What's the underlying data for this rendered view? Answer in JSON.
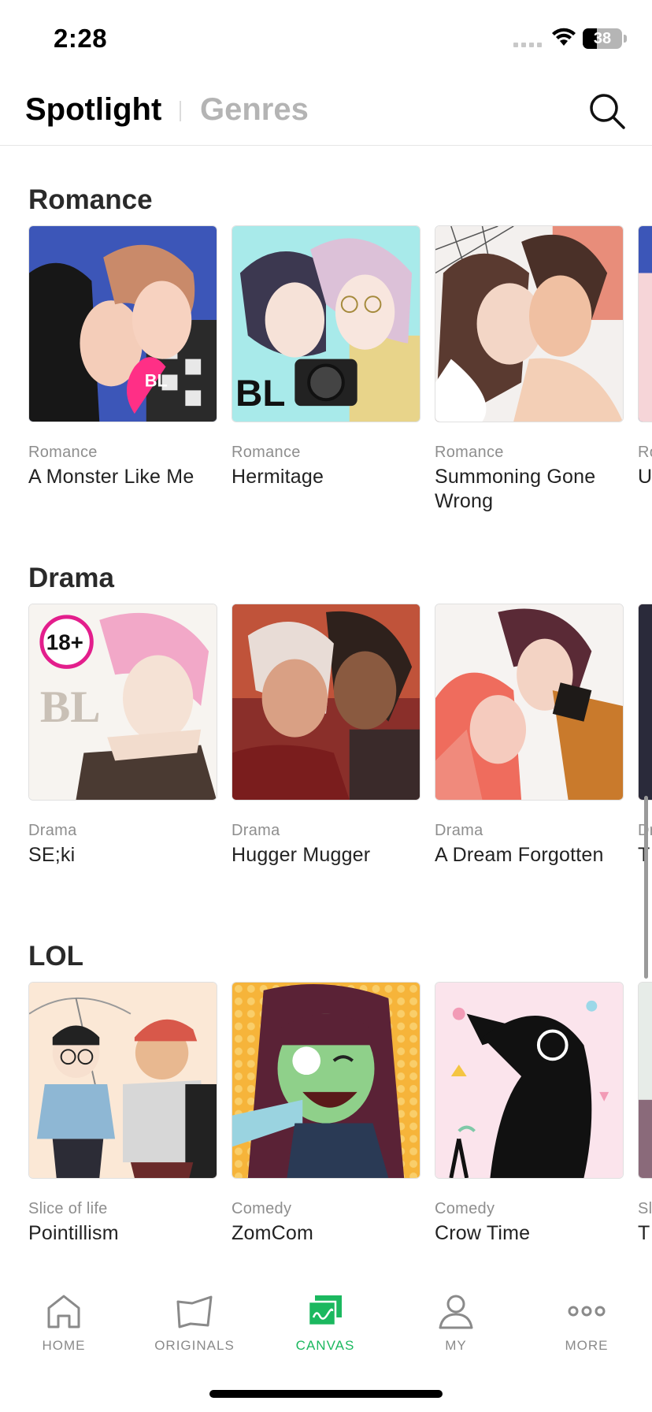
{
  "status_bar": {
    "time": "2:28",
    "battery": "38"
  },
  "header": {
    "tabs": [
      {
        "label": "Spotlight",
        "active": true
      },
      {
        "label": "Genres",
        "active": false
      }
    ],
    "search_icon": "search-icon"
  },
  "sections": [
    {
      "title": "Romance",
      "cards": [
        {
          "genre": "Romance",
          "title": "A Monster Like Me"
        },
        {
          "genre": "Romance",
          "title": "Hermitage"
        },
        {
          "genre": "Romance",
          "title": "Summoning Gone Wrong"
        },
        {
          "genre": "Ro",
          "title": "U D"
        }
      ]
    },
    {
      "title": "Drama",
      "cards": [
        {
          "genre": "Drama",
          "title": "SE;ki"
        },
        {
          "genre": "Drama",
          "title": "Hugger Mugger"
        },
        {
          "genre": "Drama",
          "title": "A Dream Forgotten"
        },
        {
          "genre": "Dr",
          "title": "T (C"
        }
      ]
    },
    {
      "title": "LOL",
      "cards": [
        {
          "genre": "Slice of life",
          "title": "Pointillism"
        },
        {
          "genre": "Comedy",
          "title": "ZomCom"
        },
        {
          "genre": "Comedy",
          "title": "Crow Time"
        },
        {
          "genre": "Sl",
          "title": "T th"
        }
      ]
    }
  ],
  "bottom_nav": [
    {
      "label": "HOME",
      "icon": "home-icon",
      "active": false
    },
    {
      "label": "ORIGINALS",
      "icon": "originals-icon",
      "active": false
    },
    {
      "label": "CANVAS",
      "icon": "canvas-icon",
      "active": true
    },
    {
      "label": "MY",
      "icon": "person-icon",
      "active": false
    },
    {
      "label": "MORE",
      "icon": "more-dots-icon",
      "active": false
    }
  ],
  "colors": {
    "accent": "#1bb85f",
    "inactive_nav": "#8a8a8a",
    "genre_text": "#8e8e8e"
  }
}
